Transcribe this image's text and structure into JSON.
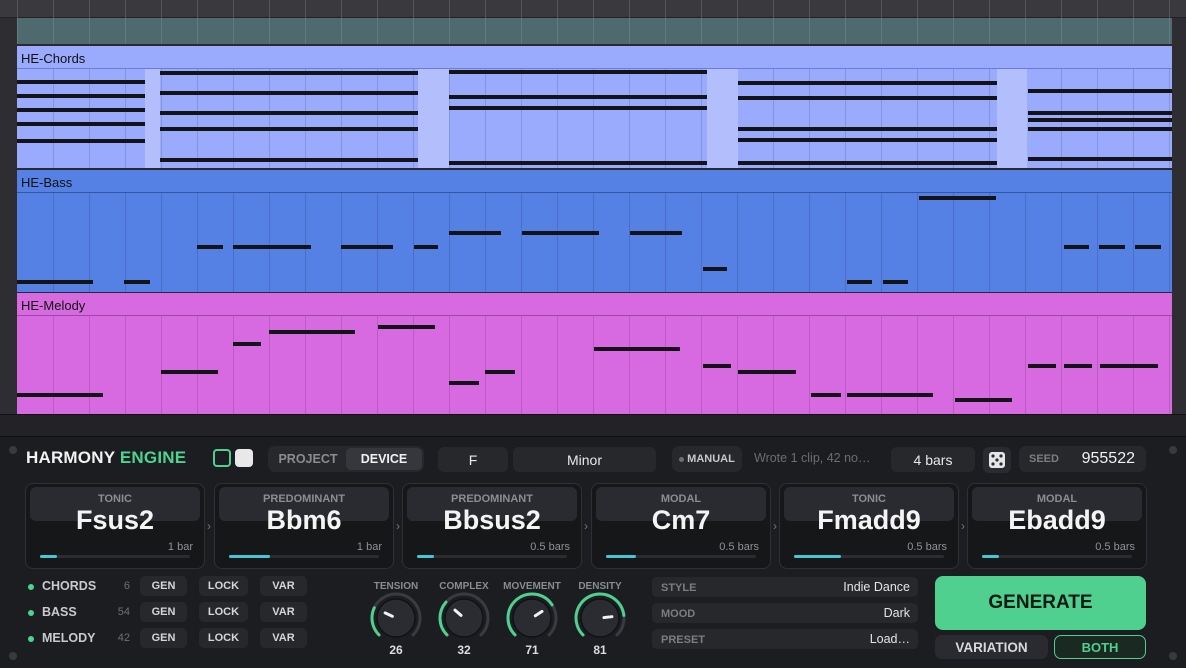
{
  "arrangement": {
    "tracks": [
      {
        "name": "HE-Chords",
        "color": "#9aaafc"
      },
      {
        "name": "HE-Bass",
        "color": "#5681e4"
      },
      {
        "name": "HE-Melody",
        "color": "#d76ae0"
      }
    ]
  },
  "device": {
    "title_main": "HARMONY",
    "title_accent": "ENGINE",
    "mode_tabs": [
      "PROJECT",
      "DEVICE"
    ],
    "active_mode": "DEVICE",
    "key": "F",
    "scale": "Minor",
    "manual_label": "MANUAL",
    "status_text": "Wrote 1 clip, 42 no…",
    "length": "4 bars",
    "dice_icon": "dice-icon",
    "seed_label": "SEED",
    "seed_value": "955522",
    "chords": [
      {
        "function": "TONIC",
        "name": "Fsus2",
        "length": "1 bar",
        "fill": 0.11
      },
      {
        "function": "PREDOMINANT",
        "name": "Bbm6",
        "length": "1 bar",
        "fill": 0.27
      },
      {
        "function": "PREDOMINANT",
        "name": "Bbsus2",
        "length": "0.5 bars",
        "fill": 0.11
      },
      {
        "function": "MODAL",
        "name": "Cm7",
        "length": "0.5 bars",
        "fill": 0.2
      },
      {
        "function": "TONIC",
        "name": "Fmadd9",
        "length": "0.5 bars",
        "fill": 0.31
      },
      {
        "function": "MODAL",
        "name": "Ebadd9",
        "length": "0.5 bars",
        "fill": 0.11
      }
    ],
    "track_rows": [
      {
        "name": "CHORDS",
        "count": "6"
      },
      {
        "name": "BASS",
        "count": "54"
      },
      {
        "name": "MELODY",
        "count": "42"
      }
    ],
    "row_buttons": {
      "gen": "GEN",
      "lock": "LOCK",
      "var": "VAR"
    },
    "knobs": [
      {
        "label": "TENSION",
        "value": "26",
        "level": 0.26
      },
      {
        "label": "COMPLEX",
        "value": "32",
        "level": 0.32
      },
      {
        "label": "MOVEMENT",
        "value": "71",
        "level": 0.71
      },
      {
        "label": "DENSITY",
        "value": "81",
        "level": 0.81
      }
    ],
    "params": [
      {
        "label": "STYLE",
        "value": "Indie Dance"
      },
      {
        "label": "MOOD",
        "value": "Dark"
      },
      {
        "label": "PRESET",
        "value": "Load…"
      }
    ],
    "generate_label": "GENERATE",
    "variation_label": "VARIATION",
    "both_label": "BOTH",
    "colors": {
      "accent": "#4fd08f",
      "bar": "#48c6d6",
      "panel": "#1c1d20"
    }
  }
}
